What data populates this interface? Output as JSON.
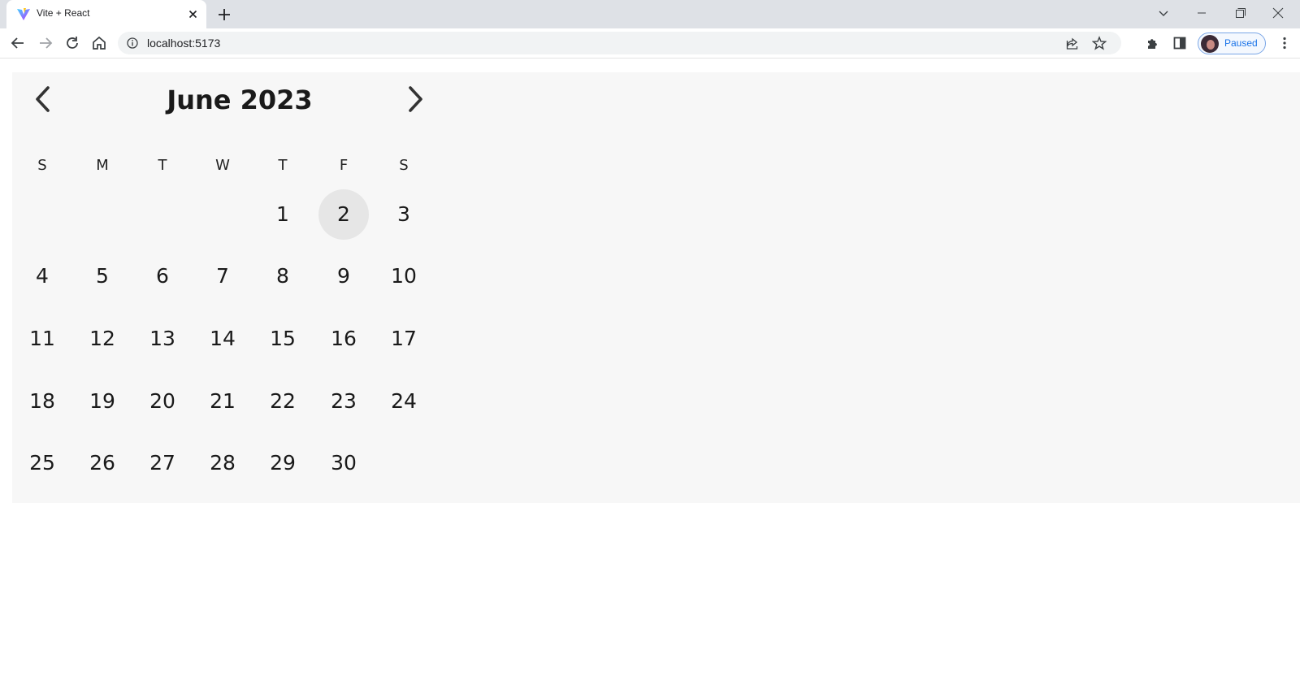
{
  "browser": {
    "tab_title": "Vite + React",
    "url": "localhost:5173",
    "profile_status": "Paused"
  },
  "calendar": {
    "month_label": "June 2023",
    "selected_day": 2,
    "weekdays": [
      "S",
      "M",
      "T",
      "W",
      "T",
      "F",
      "S"
    ],
    "days": [
      1,
      2,
      3,
      4,
      5,
      6,
      7,
      8,
      9,
      10,
      11,
      12,
      13,
      14,
      15,
      16,
      17,
      18,
      19,
      20,
      21,
      22,
      23,
      24,
      25,
      26,
      27,
      28,
      29,
      30
    ],
    "first_weekday_index": 4
  },
  "colors": {
    "calendar_background": "#f7f7f7",
    "selected_day_background": "#e6e6e6",
    "text": "#1a1a1a"
  },
  "icons": {
    "prev": "chevron-left-icon",
    "next": "chevron-right-icon"
  }
}
